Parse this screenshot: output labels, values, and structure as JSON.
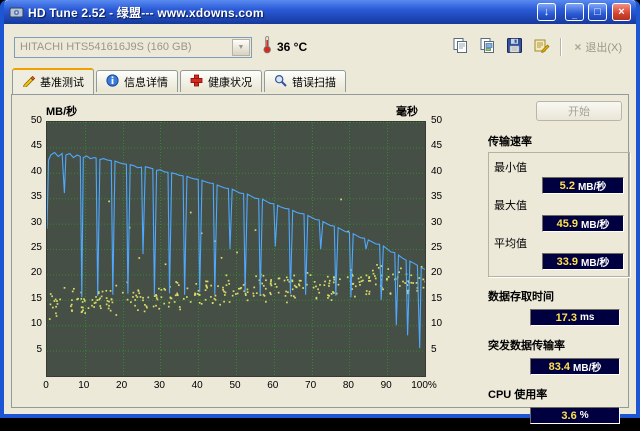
{
  "window": {
    "title": "HD Tune 2.52 - 绿盟--- www.xdowns.com"
  },
  "icons": {
    "download": "↓",
    "minimize": "_",
    "maximize": "□",
    "close": "×",
    "combo_arrow": "▼",
    "exit_x": "×"
  },
  "colors": {
    "plot_bg": "#454F45",
    "grid": "#2F8F2F",
    "line": "#4FA8FF",
    "scatter": "#E3E36A",
    "valuebox_bg": "#000040",
    "value_color": "#FFE14D",
    "unit_color": "#FFFFFF"
  },
  "toolbar": {
    "drive": "HITACHI HTS541616J9S (160 GB)",
    "temperature": "36 °C",
    "exit_label": "退出(X)"
  },
  "tabs": [
    {
      "label": "基准测试",
      "icon": "benchmark-icon",
      "active": true
    },
    {
      "label": "信息详情",
      "icon": "info-icon",
      "active": false
    },
    {
      "label": "健康状况",
      "icon": "health-icon",
      "active": false
    },
    {
      "label": "错误扫描",
      "icon": "scan-icon",
      "active": false
    }
  ],
  "side": {
    "start_label": "开始",
    "transfer": {
      "title": "传输速率",
      "rows": [
        {
          "label": "最小值",
          "value": "5.2",
          "unit": "MB/秒"
        },
        {
          "label": "最大值",
          "value": "45.9",
          "unit": "MB/秒"
        },
        {
          "label": "平均值",
          "value": "33.9",
          "unit": "MB/秒"
        }
      ]
    },
    "stats": [
      {
        "label": "数据存取时间",
        "value": "17.3",
        "unit": "ms"
      },
      {
        "label": "突发数据传输率",
        "value": "83.4",
        "unit": "MB/秒"
      },
      {
        "label": "CPU 使用率",
        "value": "3.6",
        "unit": "%"
      }
    ]
  },
  "chart_data": {
    "type": "line",
    "title": "HD Tune benchmark transfer rate with access time scatter",
    "left_axis_label": "MB/秒",
    "right_axis_label": "毫秒",
    "xlim": [
      0,
      100
    ],
    "ylim": [
      0,
      50
    ],
    "grid": true,
    "x_ticks": [
      "0",
      "10",
      "20",
      "30",
      "40",
      "50",
      "60",
      "70",
      "80",
      "90",
      "100%"
    ],
    "y_ticks": [
      50,
      45,
      40,
      35,
      30,
      25,
      20,
      15,
      10,
      5
    ],
    "series": [
      {
        "name": "传输速率",
        "type": "line",
        "x": [
          0,
          0.4,
          1,
          2,
          3,
          4,
          4.6,
          5,
          6,
          7,
          8,
          8.8,
          9.2,
          9.6,
          10.5,
          11.5,
          12.5,
          13,
          13.4,
          14,
          15,
          16,
          17,
          17.4,
          18,
          19,
          20,
          21,
          21.4,
          22,
          23,
          24,
          25,
          25.4,
          26,
          27,
          28,
          28.4,
          29,
          30,
          31,
          32,
          32.4,
          33,
          34,
          35,
          36,
          36.4,
          37,
          38,
          39,
          40,
          40.4,
          41,
          42,
          43,
          44,
          44.4,
          45,
          46,
          47,
          48,
          48.4,
          49,
          50,
          51,
          52,
          52.4,
          53,
          54,
          55,
          56,
          56.4,
          57,
          58,
          59,
          60,
          60.4,
          61,
          62,
          63,
          64,
          64.4,
          65,
          66,
          67,
          68,
          68.4,
          69,
          70,
          71,
          72,
          72.4,
          73,
          74,
          75,
          76,
          76.4,
          77,
          78,
          79,
          80,
          80.4,
          81,
          82,
          83,
          84,
          84.4,
          85,
          86,
          87,
          88,
          88.4,
          89,
          90,
          91,
          92,
          92.4,
          93,
          94,
          95,
          95.4,
          96,
          97,
          98,
          98.6,
          99,
          100
        ],
        "y": [
          29,
          42.5,
          43.5,
          44,
          43.2,
          43.8,
          36,
          43.5,
          43.8,
          43,
          43.5,
          43.2,
          15.5,
          43,
          43.3,
          42.8,
          43,
          42.9,
          15.8,
          42.6,
          42.8,
          42.5,
          42.4,
          16,
          42.3,
          42,
          41.8,
          41.7,
          16.2,
          41.6,
          41.4,
          41,
          41.1,
          24,
          41.2,
          41,
          40.8,
          16,
          40.5,
          40.6,
          40.2,
          40.1,
          16.3,
          40,
          39.8,
          39.5,
          39.4,
          16,
          39.3,
          39,
          38.8,
          38.7,
          16.5,
          38.5,
          38.2,
          38,
          37.9,
          16,
          37.6,
          37.3,
          37,
          36.9,
          25,
          36.8,
          36.4,
          36,
          35.9,
          16.5,
          35.8,
          35.4,
          35,
          34.9,
          16,
          34.8,
          34.4,
          34,
          33.9,
          25.5,
          33.6,
          33.2,
          33,
          32.9,
          16.2,
          32.6,
          32.2,
          32,
          31.9,
          16,
          31.6,
          31.2,
          30.8,
          30.7,
          25,
          30.4,
          30,
          29.6,
          29.5,
          15.8,
          29.2,
          28.8,
          28.4,
          28.3,
          15.5,
          28,
          27.6,
          27.2,
          27.1,
          25,
          26.8,
          26.4,
          26,
          25.9,
          15,
          25.6,
          25,
          24.4,
          24.3,
          10,
          23.8,
          23.2,
          22.8,
          8,
          22.6,
          22.2,
          21.8,
          5.5,
          21.3,
          21
        ]
      },
      {
        "name": "存取时间",
        "type": "scatter",
        "generator": {
          "seed": 11,
          "count": 330,
          "base": 14.5,
          "slope": 0.05,
          "spread": 3.4,
          "outliers": 14,
          "outlier_base": 21,
          "outlier_span": 17
        }
      }
    ]
  }
}
